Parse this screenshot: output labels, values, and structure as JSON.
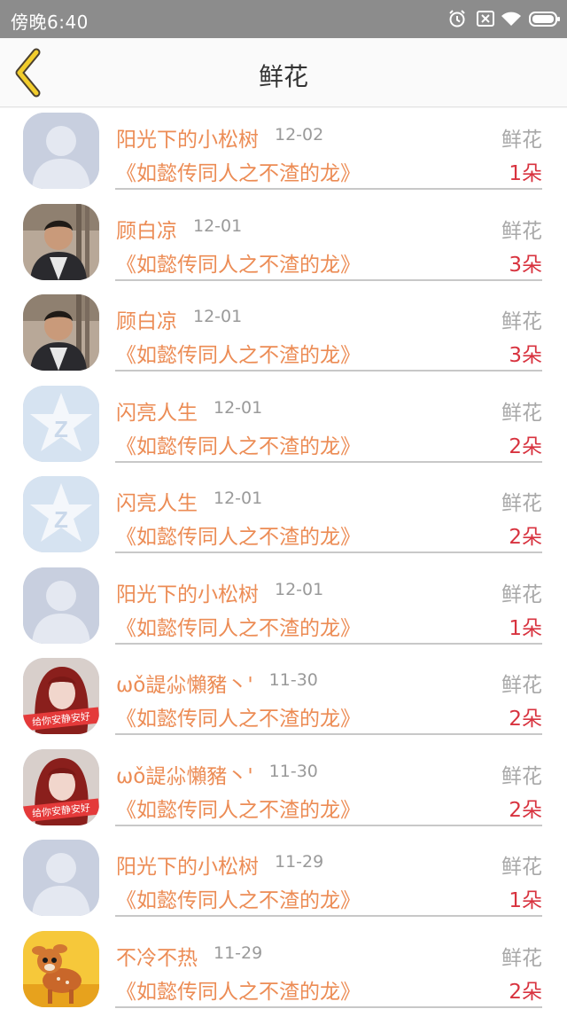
{
  "status_bar": {
    "time": "傍晚6:40",
    "icons": [
      "alarm-icon",
      "no-sim-icon",
      "wifi-icon",
      "battery-icon"
    ]
  },
  "header": {
    "title": "鲜花",
    "back_icon": "chevron-left-icon"
  },
  "colors": {
    "accent_orange": "#ec8c55",
    "count_red": "#d8333f",
    "back_yellow": "#f2cd2c"
  },
  "records": [
    {
      "name": "阳光下的小松树",
      "date": "12-02",
      "type": "鲜花",
      "book": "《如懿传同人之不渣的龙》",
      "count": "1朵",
      "avatar": "default-person"
    },
    {
      "name": "顾白凉",
      "date": "12-01",
      "type": "鲜花",
      "book": "《如懿传同人之不渣的龙》",
      "count": "3朵",
      "avatar": "photo-boy"
    },
    {
      "name": "顾白凉",
      "date": "12-01",
      "type": "鲜花",
      "book": "《如懿传同人之不渣的龙》",
      "count": "3朵",
      "avatar": "photo-boy"
    },
    {
      "name": "闪亮人生",
      "date": "12-01",
      "type": "鲜花",
      "book": "《如懿传同人之不渣的龙》",
      "count": "2朵",
      "avatar": "qzone-star"
    },
    {
      "name": "闪亮人生",
      "date": "12-01",
      "type": "鲜花",
      "book": "《如懿传同人之不渣的龙》",
      "count": "2朵",
      "avatar": "qzone-star"
    },
    {
      "name": "阳光下的小松树",
      "date": "12-01",
      "type": "鲜花",
      "book": "《如懿传同人之不渣的龙》",
      "count": "1朵",
      "avatar": "default-person"
    },
    {
      "name": "ωǒ諟尛懶豬丶'",
      "date": "11-30",
      "type": "鲜花",
      "book": "《如懿传同人之不渣的龙》",
      "count": "2朵",
      "avatar": "photo-girl"
    },
    {
      "name": "ωǒ諟尛懶豬丶'",
      "date": "11-30",
      "type": "鲜花",
      "book": "《如懿传同人之不渣的龙》",
      "count": "2朵",
      "avatar": "photo-girl"
    },
    {
      "name": "阳光下的小松树",
      "date": "11-29",
      "type": "鲜花",
      "book": "《如懿传同人之不渣的龙》",
      "count": "1朵",
      "avatar": "default-person"
    },
    {
      "name": "不冷不热",
      "date": "11-29",
      "type": "鲜花",
      "book": "《如懿传同人之不渣的龙》",
      "count": "2朵",
      "avatar": "photo-deer"
    }
  ]
}
